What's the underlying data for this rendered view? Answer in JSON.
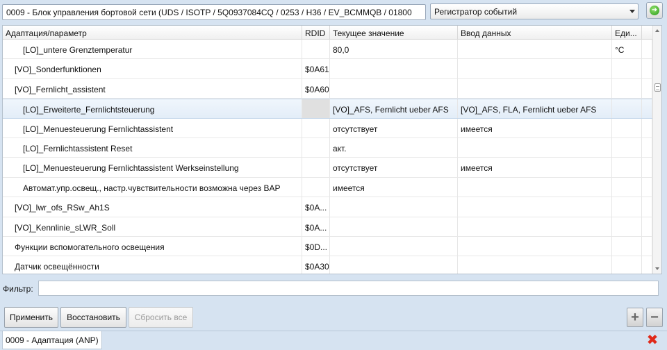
{
  "topbar": {
    "ecu_title": "0009 - Блок управления бортовой сети  (UDS / ISOTP / 5Q0937084CQ / 0253 / H36 / EV_BCMMQB / 01800",
    "mode_selected": "Регистратор событий",
    "go_icon": "green-arrow-icon"
  },
  "grid": {
    "columns": [
      "Адаптация/параметр",
      "RDID",
      "Текущее значение",
      "Ввод данных",
      "Еди..."
    ],
    "rows": [
      {
        "indent": 2,
        "param": "[LO]_untere Grenztemperatur",
        "rdid": "",
        "current": "80,0",
        "input": "",
        "unit": "°C",
        "selected": false
      },
      {
        "indent": 1,
        "param": "[VO]_Sonderfunktionen",
        "rdid": "$0A61",
        "current": "",
        "input": "",
        "unit": "",
        "selected": false
      },
      {
        "indent": 1,
        "param": "[VO]_Fernlicht_assistent",
        "rdid": "$0A60",
        "current": "",
        "input": "",
        "unit": "",
        "selected": false
      },
      {
        "indent": 2,
        "param": "[LO]_Erweiterte_Fernlichtsteuerung",
        "rdid": "",
        "current": "[VO]_AFS, Fernlicht ueber AFS",
        "input": "[VO]_AFS, FLA, Fernlicht ueber AFS",
        "unit": "",
        "selected": true
      },
      {
        "indent": 2,
        "param": "[LO]_Menuesteuerung Fernlichtassistent",
        "rdid": "",
        "current": "отсутствует",
        "input": "имеется",
        "unit": "",
        "selected": false
      },
      {
        "indent": 2,
        "param": "[LO]_Fernlichtassistent Reset",
        "rdid": "",
        "current": "акт.",
        "input": "",
        "unit": "",
        "selected": false
      },
      {
        "indent": 2,
        "param": "[LO]_Menuesteuerung Fernlichtassistent Werkseinstellung",
        "rdid": "",
        "current": "отсутствует",
        "input": "имеется",
        "unit": "",
        "selected": false
      },
      {
        "indent": 2,
        "param": "Автомат.упр.освещ., настр.чувствительности возможна через BAP",
        "rdid": "",
        "current": "имеется",
        "input": "",
        "unit": "",
        "selected": false
      },
      {
        "indent": 1,
        "param": "[VO]_lwr_ofs_RSw_Ah1S",
        "rdid": "$0A...",
        "current": "",
        "input": "",
        "unit": "",
        "selected": false
      },
      {
        "indent": 1,
        "param": "[VO]_Kennlinie_sLWR_Soll",
        "rdid": "$0A...",
        "current": "",
        "input": "",
        "unit": "",
        "selected": false
      },
      {
        "indent": 1,
        "param": "Функции вспомогательного освещения",
        "rdid": "$0D...",
        "current": "",
        "input": "",
        "unit": "",
        "selected": false
      },
      {
        "indent": 1,
        "param": "Датчик освещённости",
        "rdid": "$0A30",
        "current": "",
        "input": "",
        "unit": "",
        "selected": false
      }
    ]
  },
  "filter": {
    "label": "Фильтр:",
    "value": "",
    "placeholder": ""
  },
  "buttons": {
    "apply": "Применить",
    "restore": "Восстановить",
    "reset_all": "Сбросить все",
    "plus": "+",
    "minus": "−"
  },
  "status": {
    "tab_label": "0009 - Адаптация (ANP)",
    "close_icon": "red-x-icon"
  }
}
